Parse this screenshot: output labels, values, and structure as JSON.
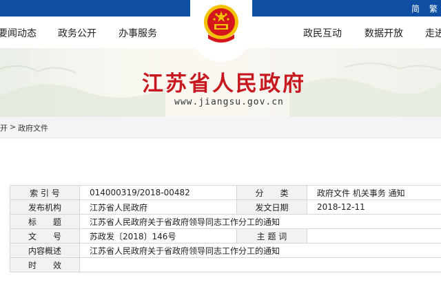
{
  "topbar": {
    "simplified": "简",
    "traditional": "繁"
  },
  "nav": {
    "left": [
      "要闻动态",
      "政务公开",
      "办事服务"
    ],
    "right": [
      "政民互动",
      "数据开放",
      "走进"
    ]
  },
  "banner": {
    "title": "江苏省人民政府",
    "url": "www.jiangsu.gov.cn"
  },
  "breadcrumb": {
    "prev": "开",
    "sep": ">",
    "current": "政府文件"
  },
  "meta": {
    "rows": [
      {
        "l1": "索 引 号",
        "v1": "014000319/2018-00482",
        "l2": "分　　类",
        "v2": "政府文件 机关事务 通知"
      },
      {
        "l1": "发布机构",
        "v1": "江苏省人民政府",
        "l2": "发文日期",
        "v2": "2018-12-11"
      },
      {
        "l1": "标　　题",
        "v": "江苏省人民政府关于省政府领导同志工作分工的通知"
      },
      {
        "l1": "文　　号",
        "v1": "苏政发〔2018〕146号",
        "l2": "主 题 词",
        "v2": ""
      },
      {
        "l1": "内容概述",
        "v": "江苏省人民政府关于省政府领导同志工作分工的通知"
      },
      {
        "l1": "时　　效",
        "v": ""
      }
    ]
  },
  "colors": {
    "brand_red": "#c8181f",
    "topbar_blue": "#0f4fa3",
    "emblem_gold": "#f2c200"
  }
}
